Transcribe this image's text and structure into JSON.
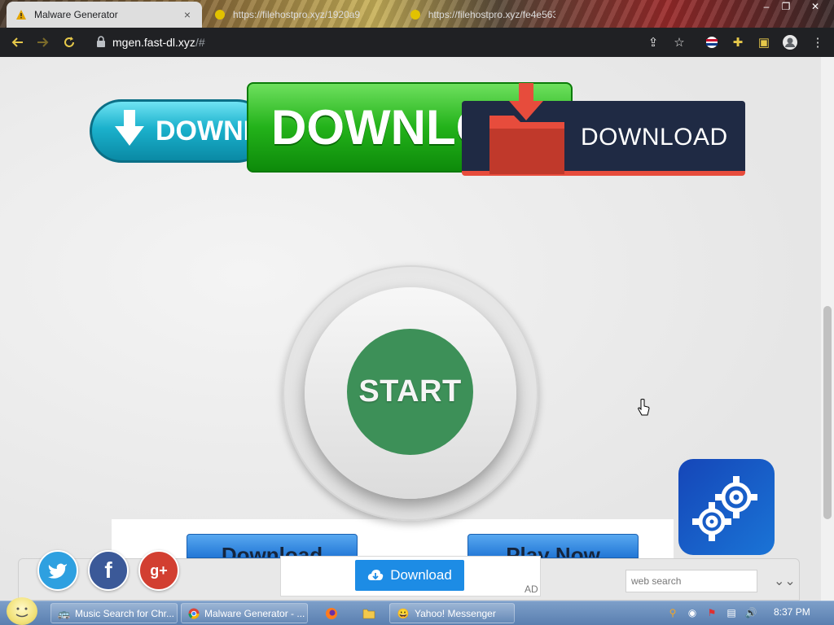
{
  "browser": {
    "tabs": [
      {
        "label": "Malware Generator",
        "active": true
      },
      {
        "label": "https://filehostpro.xyz/1920a9",
        "active": false
      },
      {
        "label": "https://filehostpro.xyz/fe4e563",
        "active": false
      }
    ],
    "address": {
      "host": "mgen.fast-dl.xyz",
      "path": "/#"
    }
  },
  "page": {
    "teal_button_label": "DOWNL",
    "green_button_label": "DOWNLO",
    "dark_button_label": "DOWNLOAD",
    "start_button_label": "START",
    "blue_buttons": [
      "Download",
      "Play Now"
    ]
  },
  "adbar": {
    "ad_button_label": "Download",
    "ad_tag": "AD",
    "search_placeholder": "web search",
    "social": [
      "twitter",
      "facebook",
      "google-plus"
    ]
  },
  "taskbar": {
    "items": [
      {
        "label": "Music Search for Chr...",
        "icon": "music-search-icon"
      },
      {
        "label": "Malware Generator - ...",
        "icon": "chrome-icon"
      },
      {
        "label": "",
        "icon": "firefox-icon"
      },
      {
        "label": "",
        "icon": "folder-icon"
      },
      {
        "label": "Yahoo! Messenger",
        "icon": "yahoo-messenger-icon"
      }
    ],
    "clock": "8:37 PM"
  },
  "colors": {
    "start_green": "#3d9058",
    "dark_button_bg": "#1f2a44",
    "ad_button_blue": "#1d8ce5"
  }
}
